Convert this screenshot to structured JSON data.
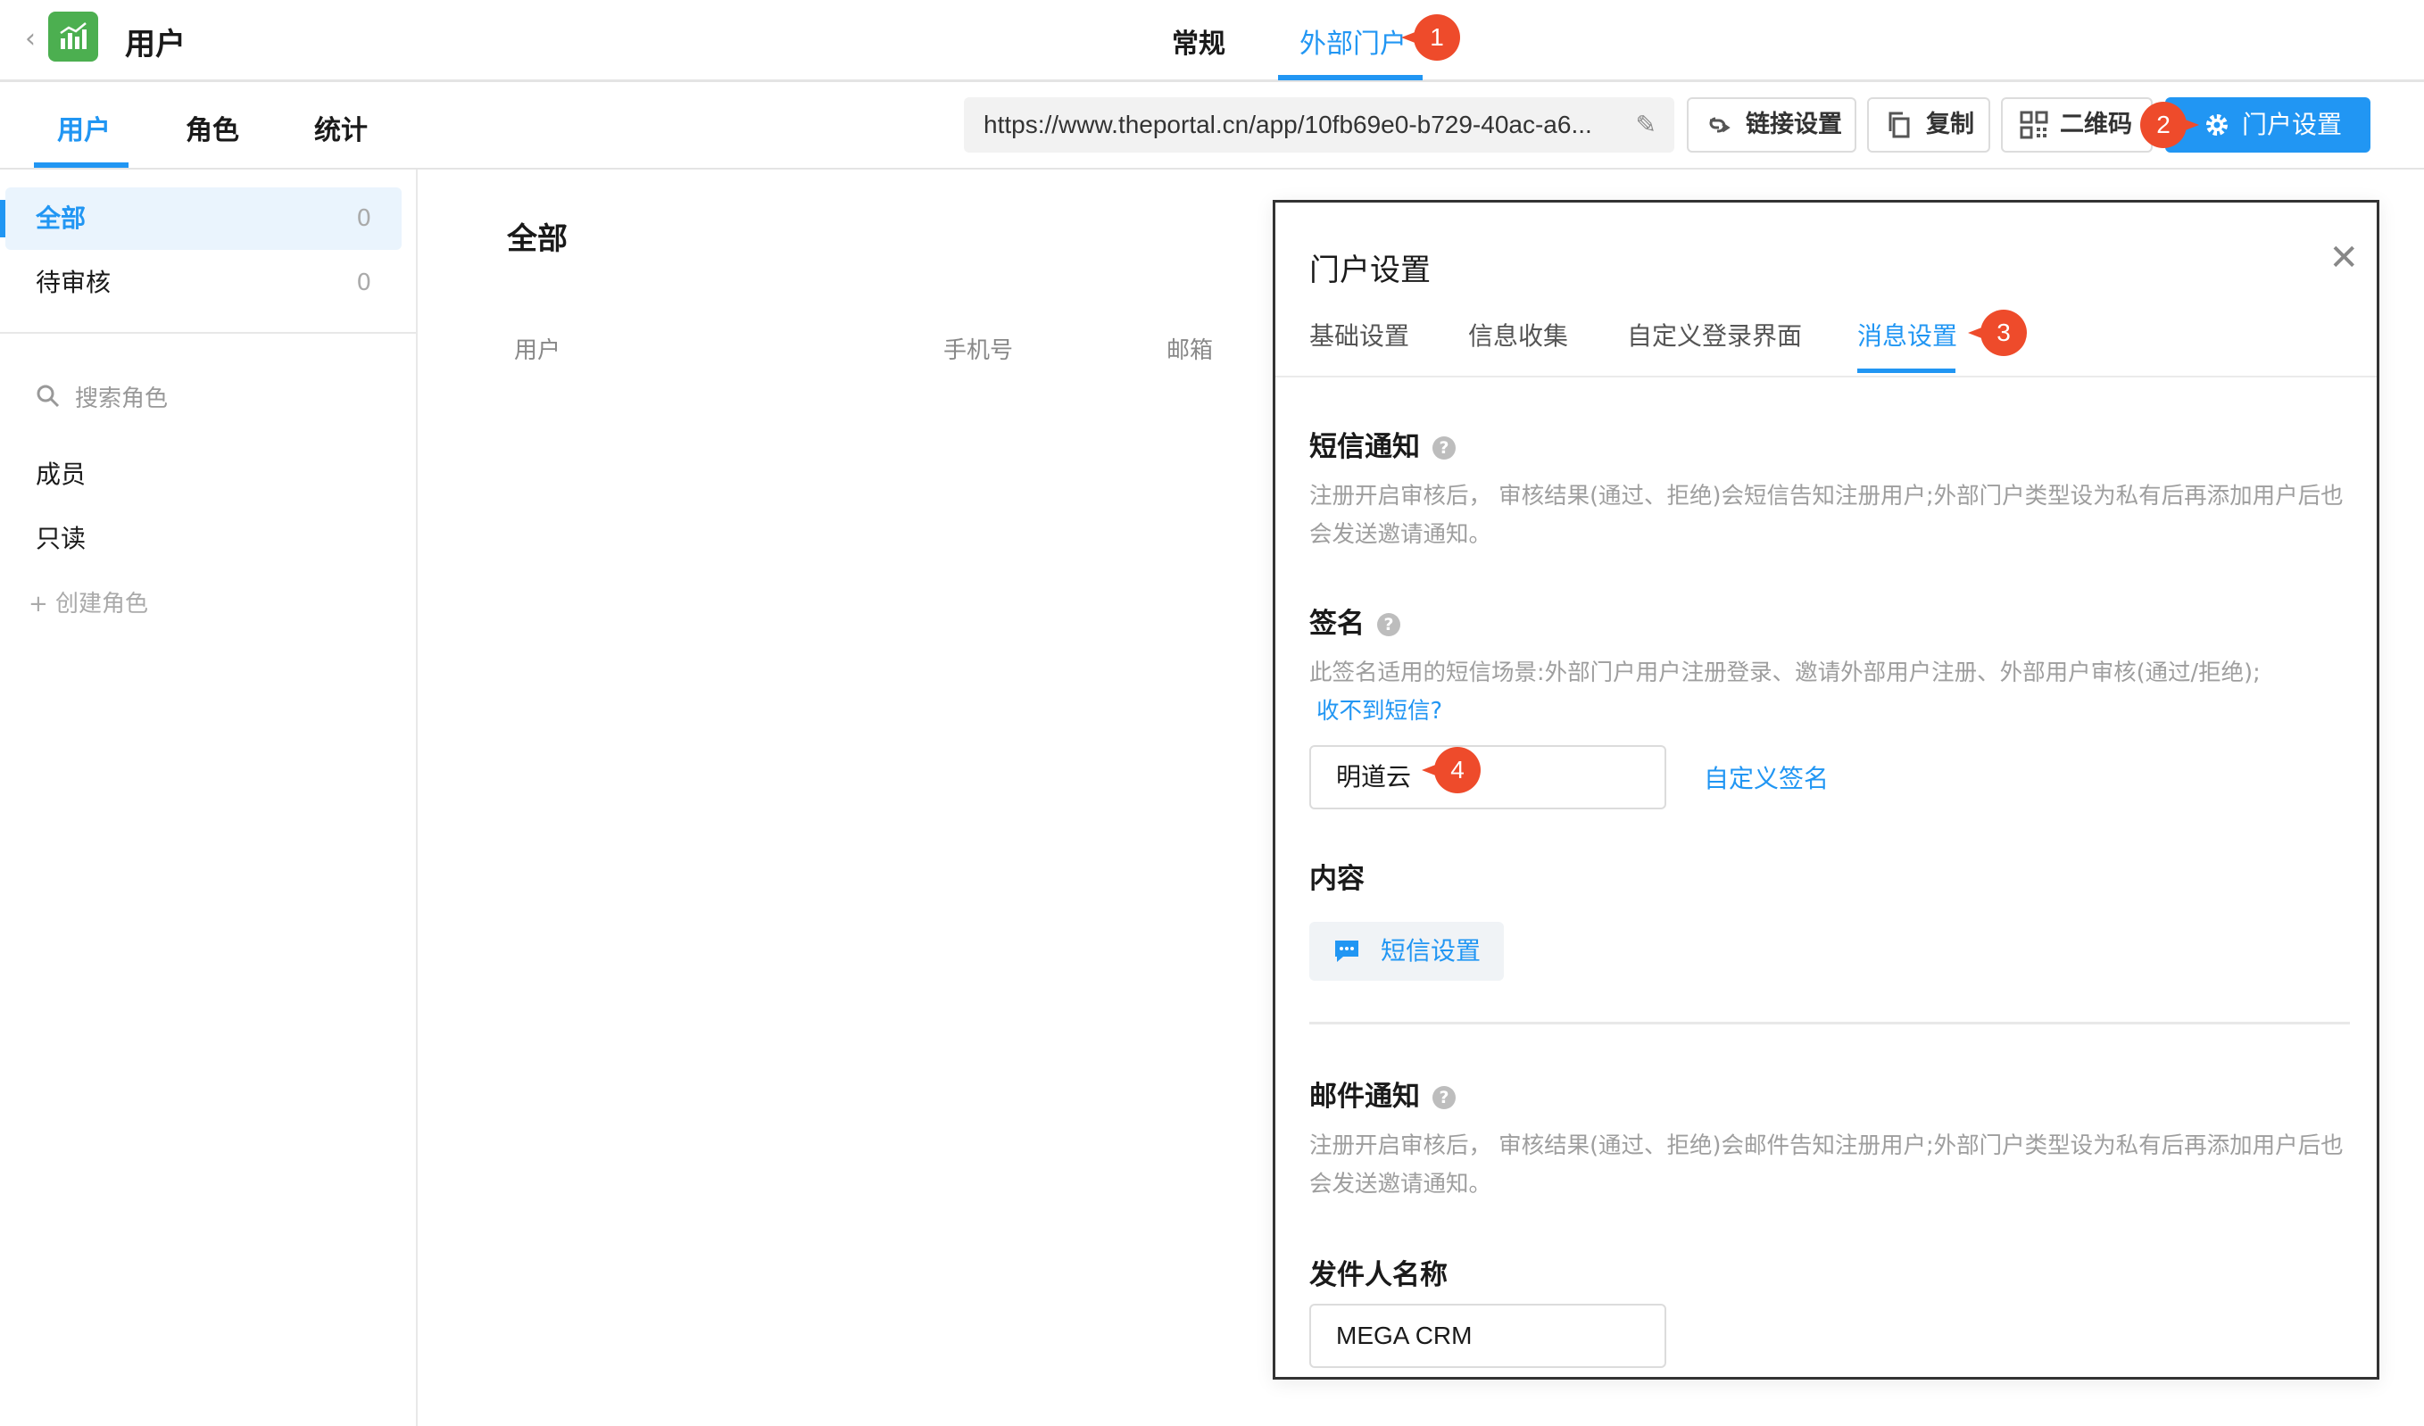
{
  "header": {
    "app_title": "用户",
    "mode_tabs": [
      {
        "label": "常规",
        "active": false
      },
      {
        "label": "外部门户",
        "active": true
      }
    ]
  },
  "subnav": {
    "tabs": [
      {
        "label": "用户",
        "active": true
      },
      {
        "label": "角色",
        "active": false
      },
      {
        "label": "统计",
        "active": false
      }
    ],
    "portal_url": "https://www.theportal.cn/app/10fb69e0-b729-40ac-a6...",
    "buttons": {
      "link_settings": "链接设置",
      "copy": "复制",
      "qrcode": "二维码",
      "portal_settings": "门户设置"
    }
  },
  "sidebar": {
    "filters": [
      {
        "label": "全部",
        "count": "0",
        "active": true
      },
      {
        "label": "待审核",
        "count": "0",
        "active": false
      }
    ],
    "search_placeholder": "搜索角色",
    "roles": [
      "成员",
      "只读"
    ],
    "create_role": "+ 创建角色"
  },
  "main": {
    "title": "全部",
    "columns": [
      "用户",
      "手机号",
      "邮箱"
    ]
  },
  "dialog": {
    "title": "门户设置",
    "tabs": [
      {
        "label": "基础设置",
        "active": false
      },
      {
        "label": "信息收集",
        "active": false
      },
      {
        "label": "自定义登录界面",
        "active": false
      },
      {
        "label": "消息设置",
        "active": true
      }
    ],
    "sms": {
      "title": "短信通知",
      "description": "注册开启审核后， 审核结果(通过、拒绝)会短信告知注册用户;外部门户类型设为私有后再添加用户后也会发送邀请通知。"
    },
    "signature": {
      "title": "签名",
      "description": "此签名适用的短信场景:外部门户用户注册登录、邀请外部用户注册、外部用户审核(通过/拒绝);",
      "help_link": "收不到短信?",
      "value": "明道云",
      "custom_link": "自定义签名"
    },
    "content": {
      "title": "内容",
      "sms_button": "短信设置"
    },
    "email": {
      "title": "邮件通知",
      "description": "注册开启审核后， 审核结果(通过、拒绝)会邮件告知注册用户;外部门户类型设为私有后再添加用户后也会发送邀请通知。"
    },
    "sender": {
      "title": "发件人名称",
      "value": "MEGA CRM"
    }
  },
  "annotations": [
    "1",
    "2",
    "3",
    "4"
  ],
  "colors": {
    "accent": "#2196f3",
    "badge": "#ee4b2b",
    "app_icon": "#4caf50"
  }
}
